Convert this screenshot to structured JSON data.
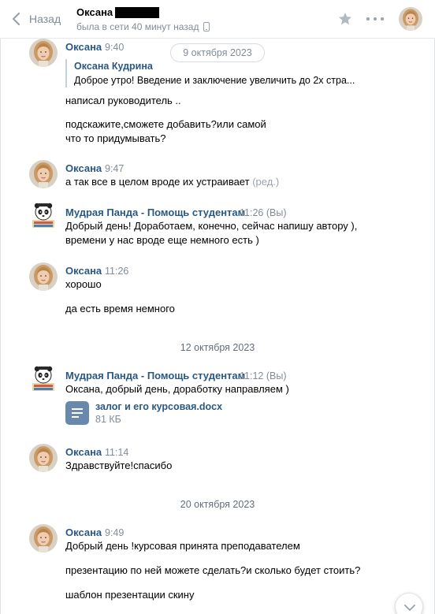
{
  "header": {
    "back_label": "Назад",
    "peer_name": "Оксана",
    "peer_status": "была в сети 40 минут назад"
  },
  "messages": [
    {
      "author": "Оксана",
      "time": "9:40",
      "date_pill": "9 октября 2023",
      "quote": {
        "author": "Оксана Кудрина",
        "text": "Доброе утро! Введение и заключение увеличить до 2х стра..."
      },
      "lines": [
        "написал руководитель ..",
        "подскажите,сможете добавить?или самой",
        "что то придумывать?"
      ]
    },
    {
      "author": "Оксана",
      "time": "9:47",
      "lines": [
        "а так все в целом вроде их устраивает"
      ],
      "edited": "(ред.)"
    },
    {
      "author": "Мудрая Панда - Помощь студентам",
      "time": "11:26",
      "you": "(Вы)",
      "lines": [
        "Добрый день! Доработаем, конечно, сейчас напишу автору ),",
        "времени у нас вроде еще немного есть )"
      ]
    },
    {
      "author": "Оксана",
      "time": "11:26",
      "lines": [
        "хорошо",
        "да есть время немного"
      ]
    },
    {
      "date_separator": "12 октября 2023"
    },
    {
      "author": "Мудрая Панда - Помощь студентам",
      "time": "11:12",
      "you": "(Вы)",
      "lines": [
        "Оксана, добрый день, доработку направляем )"
      ],
      "attachment": {
        "name": "залог и его курсовая.docx",
        "size": "81 КБ"
      }
    },
    {
      "author": "Оксана",
      "time": "11:14",
      "lines": [
        "Здравствуйте!спасибо"
      ]
    },
    {
      "date_separator": "20 октября 2023"
    },
    {
      "author": "Оксана",
      "time": "9:49",
      "lines": [
        "Добрый день !курсовая принята преподавателем",
        "презентацию по ней можете сделать?и сколько будет стоить?",
        "шаблон презентации скину"
      ]
    }
  ],
  "icons": {
    "back": "chevron-left-icon",
    "star": "star-icon",
    "more": "more-dots-icon",
    "phone": "mobile-phone-icon",
    "document": "document-icon",
    "scroll_down": "chevron-down-icon"
  },
  "colors": {
    "link": "#2a5885",
    "muted": "#818c99",
    "doc_icon": "#6888ad"
  }
}
